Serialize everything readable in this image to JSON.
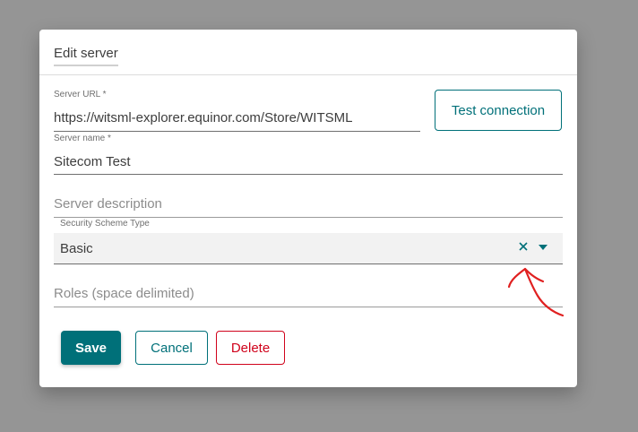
{
  "dialog": {
    "title": "Edit server"
  },
  "server_url": {
    "label": "Server URL *",
    "value": "https://witsml-explorer.equinor.com/Store/WITSML"
  },
  "test_connection": {
    "label": "Test connection"
  },
  "server_name": {
    "label": "Server name *",
    "value": "Sitecom Test"
  },
  "server_description": {
    "placeholder": "Server description"
  },
  "security_scheme": {
    "label": "Security Scheme Type",
    "value": "Basic"
  },
  "roles": {
    "placeholder": "Roles (space delimited)"
  },
  "actions": {
    "save": "Save",
    "cancel": "Cancel",
    "delete": "Delete"
  },
  "colors": {
    "accent": "#007079",
    "danger": "#d0021b",
    "backdrop": "#959595",
    "annotation": "#e02020"
  },
  "icons": {
    "clear": "close-icon",
    "dropdown": "chevron-down-icon"
  }
}
